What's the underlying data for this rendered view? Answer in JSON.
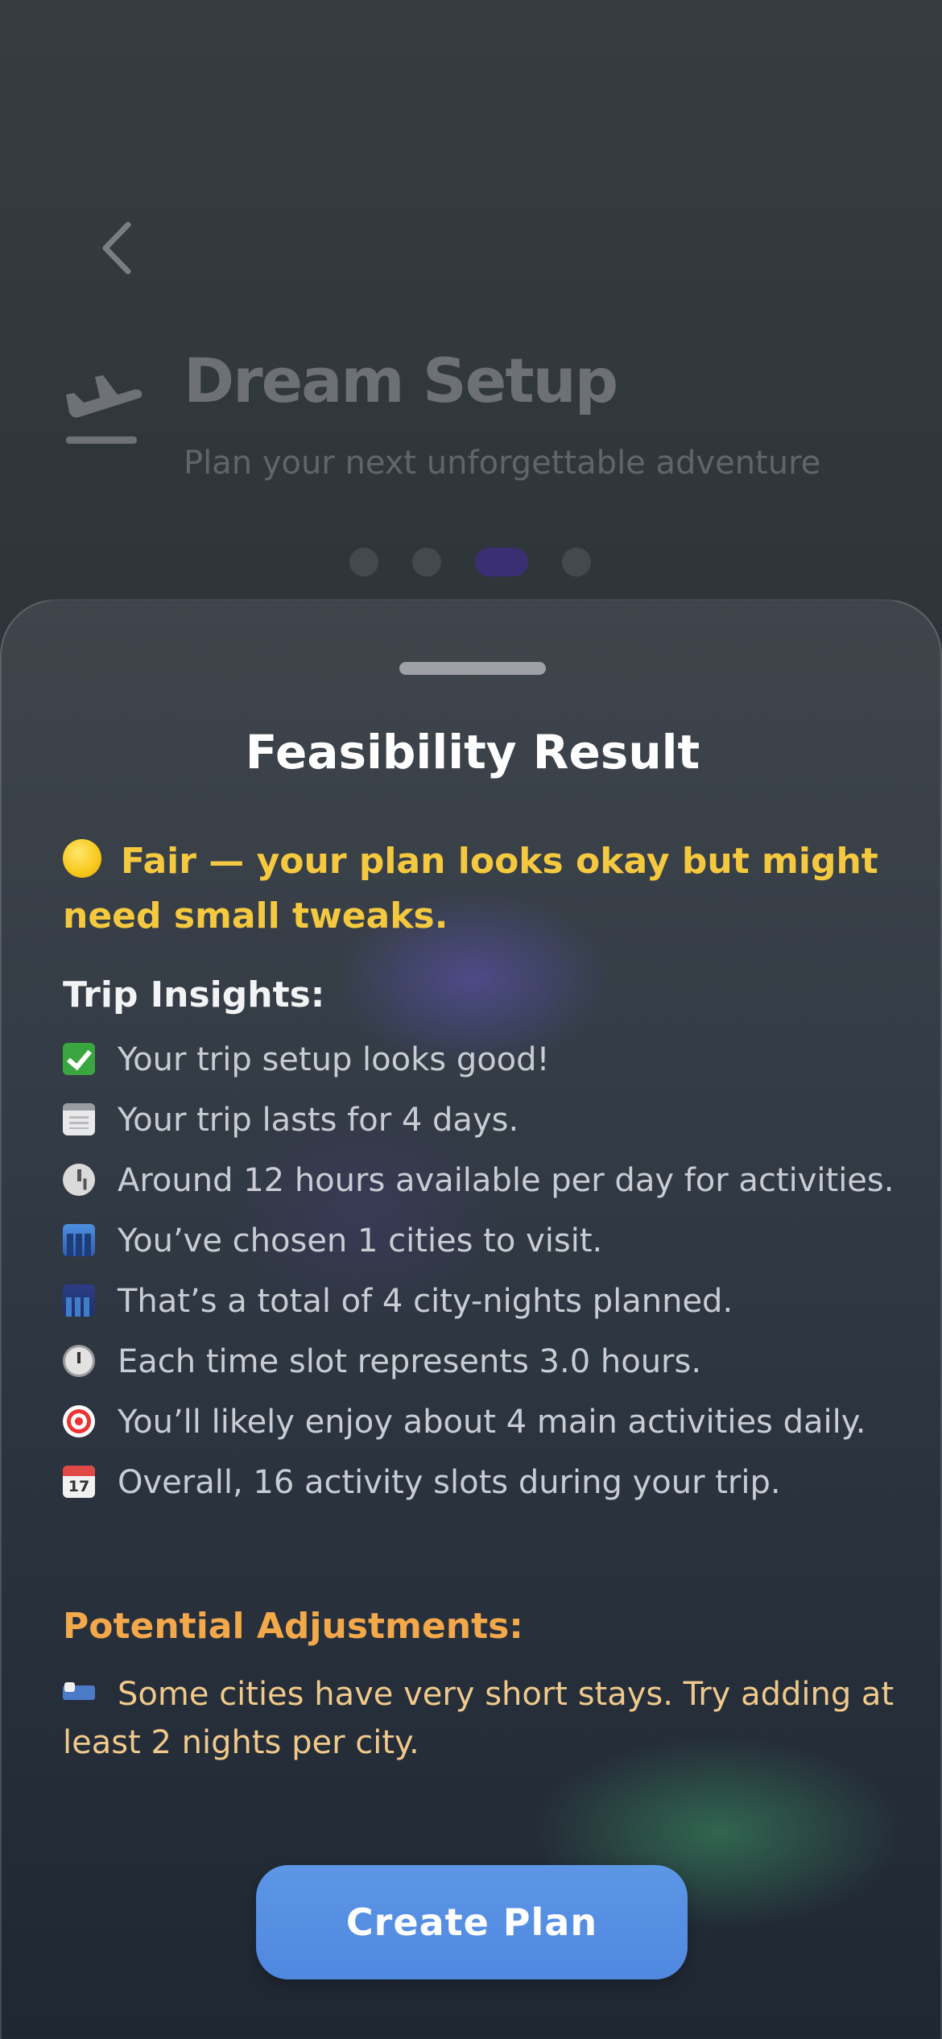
{
  "background_page": {
    "title": "Dream Setup",
    "subtitle": "Plan your next unforgettable adventure",
    "back_icon": "chevron-left-icon",
    "hero_icon": "airplane-takeoff-icon",
    "pager": {
      "total_steps": 4,
      "current_step": 3
    }
  },
  "sheet": {
    "title": "Feasibility Result",
    "verdict": {
      "icon": "yellow-circle-emoji",
      "text": "Fair — your plan looks okay but might need small tweaks."
    },
    "insights_title": "Trip Insights:",
    "insights": [
      {
        "icon": "check-mark-emoji",
        "text": "Your trip setup looks good!"
      },
      {
        "icon": "notepad-emoji",
        "text": "Your trip lasts for 4 days."
      },
      {
        "icon": "clock-emoji",
        "text": "Around 12 hours available per day for activities."
      },
      {
        "icon": "cityscape-emoji",
        "text": "You’ve chosen 1 cities to visit."
      },
      {
        "icon": "night-city-emoji",
        "text": "That’s a total of 4 city-nights planned."
      },
      {
        "icon": "stopwatch-emoji",
        "text": "Each time slot represents 3.0 hours."
      },
      {
        "icon": "target-emoji",
        "text": "You’ll likely enjoy about 4 main activities daily."
      },
      {
        "icon": "calendar-emoji",
        "text": "Overall, 16 activity slots during your trip."
      }
    ],
    "adjustments_title": "Potential Adjustments:",
    "adjustments": [
      {
        "icon": "bed-emoji",
        "text": "Some cities have very short stays. Try adding at least 2 nights per city."
      }
    ],
    "cta_label": "Create Plan"
  },
  "colors": {
    "verdict": "#f5c93f",
    "adjustments": "#f3a84a",
    "cta": "#5d96e5",
    "active_dot": "#3a2f72"
  }
}
